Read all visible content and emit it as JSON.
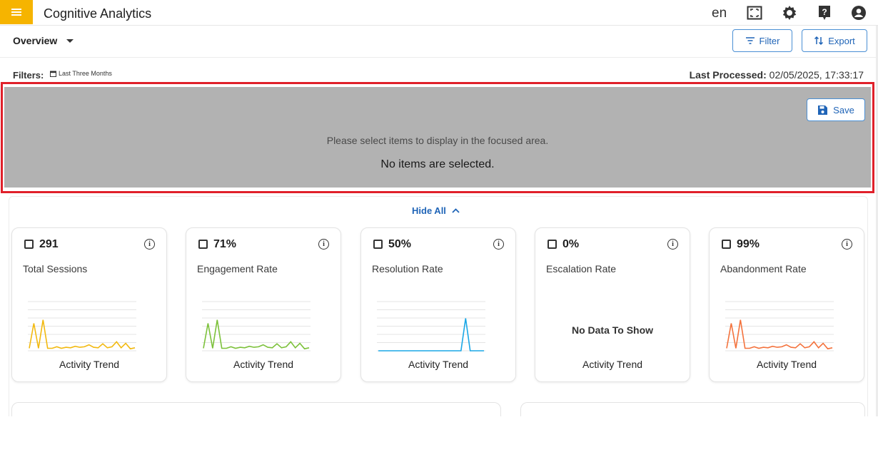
{
  "header": {
    "app_title": "Cognitive Analytics",
    "language": "en",
    "accent_color": "#f6b400",
    "icons": [
      "menu-icon",
      "fullscreen-icon",
      "settings-icon",
      "help-icon",
      "account-icon"
    ]
  },
  "subbar": {
    "view_label": "Overview",
    "filter_label": "Filter",
    "export_label": "Export"
  },
  "filters": {
    "label": "Filters:",
    "chip": "Last Three Months",
    "last_processed_label": "Last Processed:",
    "last_processed_value": "02/05/2025, 17:33:17"
  },
  "focus": {
    "save_label": "Save",
    "message": "Please select items to display in the focused area.",
    "empty": "No items are selected."
  },
  "panel": {
    "hide_all_label": "Hide All"
  },
  "cards": [
    {
      "value": "291",
      "name": "Total Sessions",
      "trend_label": "Activity Trend",
      "color": "#f2b90f",
      "trend": [
        0.05,
        0.55,
        0.05,
        0.62,
        0.05,
        0.05,
        0.08,
        0.05,
        0.07,
        0.06,
        0.09,
        0.07,
        0.08,
        0.12,
        0.07,
        0.06,
        0.14,
        0.06,
        0.08,
        0.18,
        0.06,
        0.15,
        0.04,
        0.06
      ]
    },
    {
      "value": "71%",
      "name": "Engagement Rate",
      "trend_label": "Activity Trend",
      "color": "#7cc13a",
      "trend": [
        0.05,
        0.55,
        0.05,
        0.62,
        0.05,
        0.05,
        0.08,
        0.05,
        0.07,
        0.06,
        0.09,
        0.07,
        0.08,
        0.12,
        0.07,
        0.06,
        0.14,
        0.06,
        0.08,
        0.18,
        0.06,
        0.15,
        0.04,
        0.06
      ]
    },
    {
      "value": "50%",
      "name": "Resolution Rate",
      "trend_label": "Activity Trend",
      "color": "#1aa7e6",
      "trend": [
        0,
        0,
        0,
        0,
        0,
        0,
        0,
        0,
        0,
        0,
        0,
        0,
        0,
        0,
        0,
        0,
        0,
        0,
        0,
        0.65,
        0,
        0,
        0,
        0
      ]
    },
    {
      "value": "0%",
      "name": "Escalation Rate",
      "trend_label": "Activity Trend",
      "no_data": "No Data To Show"
    },
    {
      "value": "99%",
      "name": "Abandonment Rate",
      "trend_label": "Activity Trend",
      "color": "#f4723c",
      "trend": [
        0.05,
        0.55,
        0.05,
        0.62,
        0.05,
        0.05,
        0.08,
        0.05,
        0.07,
        0.06,
        0.09,
        0.07,
        0.08,
        0.12,
        0.07,
        0.06,
        0.14,
        0.06,
        0.08,
        0.18,
        0.06,
        0.15,
        0.04,
        0.06
      ]
    }
  ]
}
